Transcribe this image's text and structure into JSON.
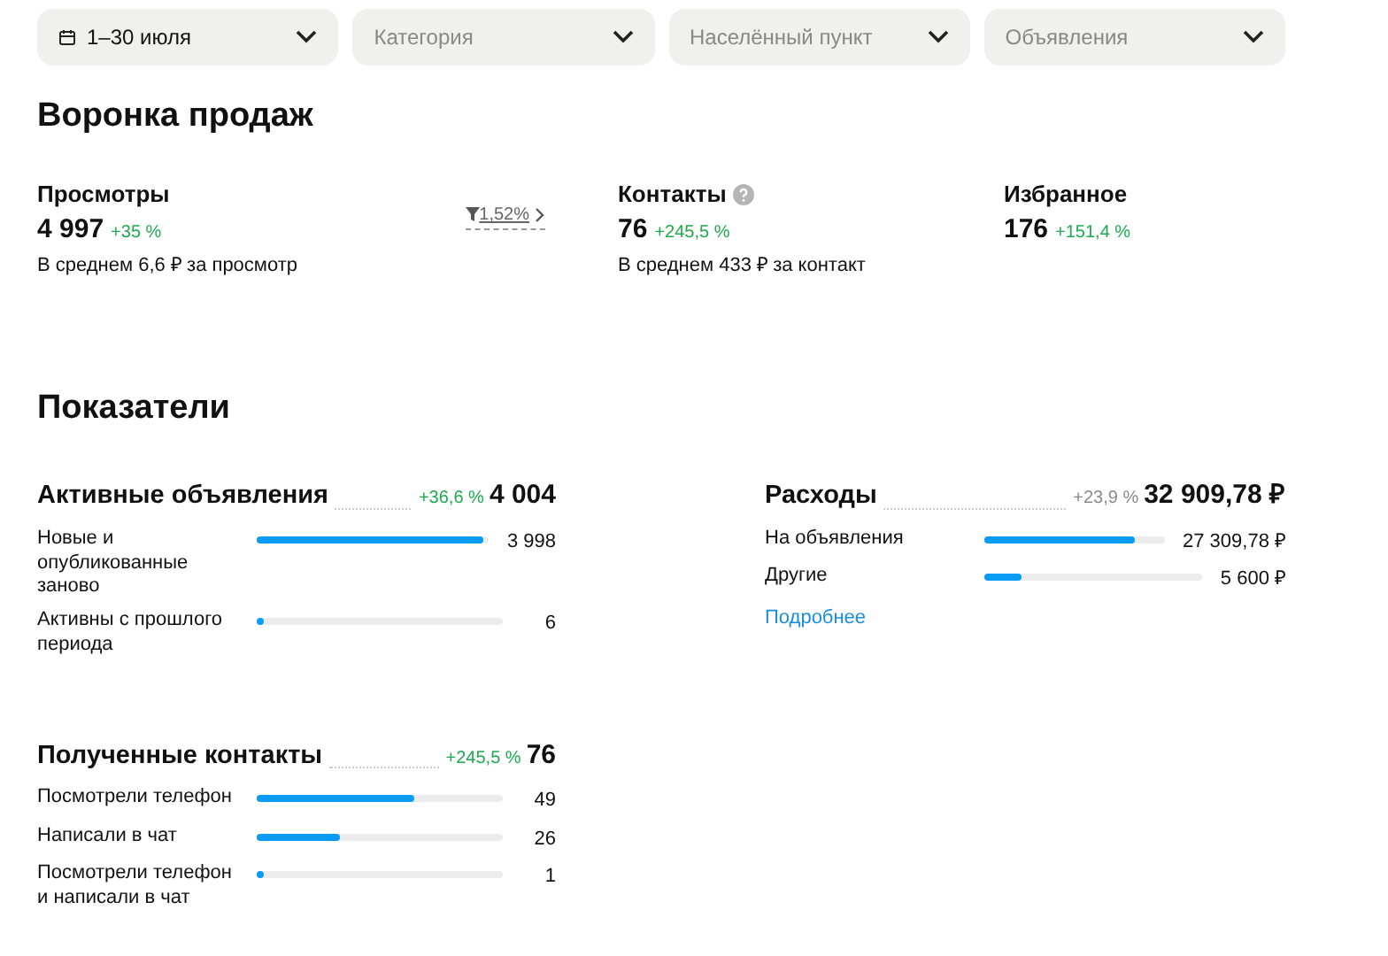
{
  "filters": [
    {
      "label": "1–30 июля",
      "icon": true,
      "placeholder": false
    },
    {
      "label": "Категория",
      "icon": false,
      "placeholder": true
    },
    {
      "label": "Населённый пункт",
      "icon": false,
      "placeholder": true
    },
    {
      "label": "Объявления",
      "icon": false,
      "placeholder": true
    }
  ],
  "funnel": {
    "title": "Воронка продаж",
    "stages": [
      {
        "name": "Просмотры",
        "help": false,
        "value": "4 997",
        "delta": "+35 %",
        "note": "В среднем 6,6 ₽ за просмотр",
        "conversion": "1,52%"
      },
      {
        "name": "Контакты",
        "help": true,
        "value": "76",
        "delta": "+245,5 %",
        "note": "В среднем 433 ₽ за контакт"
      },
      {
        "name": "Избранное",
        "help": false,
        "value": "176",
        "delta": "+151,4 %"
      }
    ]
  },
  "metrics": {
    "title": "Показатели",
    "groups": [
      {
        "title": "Активные объявления",
        "delta": "+36,6 %",
        "delta_positive": true,
        "total": "4 004",
        "rows": [
          {
            "label": "Новые и опубликованные заново",
            "level": 0.97,
            "value": "3 998"
          },
          {
            "label": "Активны с прошлого периода",
            "level": 0.03,
            "value": "6"
          }
        ]
      },
      {
        "title": "Расходы",
        "delta": "+23,9 %",
        "delta_positive": false,
        "total": "32 909,78 ₽",
        "link": "Подробнее",
        "rows": [
          {
            "label": "На объявления",
            "level": 0.83,
            "value": "27 309,78 ₽"
          },
          {
            "label": "Другие",
            "level": 0.17,
            "value": "5 600 ₽"
          }
        ]
      },
      {
        "title": "Полученные контакты",
        "delta": "+245,5 %",
        "delta_positive": true,
        "total": "76",
        "rows": [
          {
            "label": "Посмотрели телефон",
            "level": 0.64,
            "value": "49"
          },
          {
            "label": "Написали в чат",
            "level": 0.34,
            "value": "26"
          },
          {
            "label": "Посмотрели телефон и написали в чат",
            "level": 0.02,
            "value": "1"
          }
        ]
      }
    ]
  }
}
